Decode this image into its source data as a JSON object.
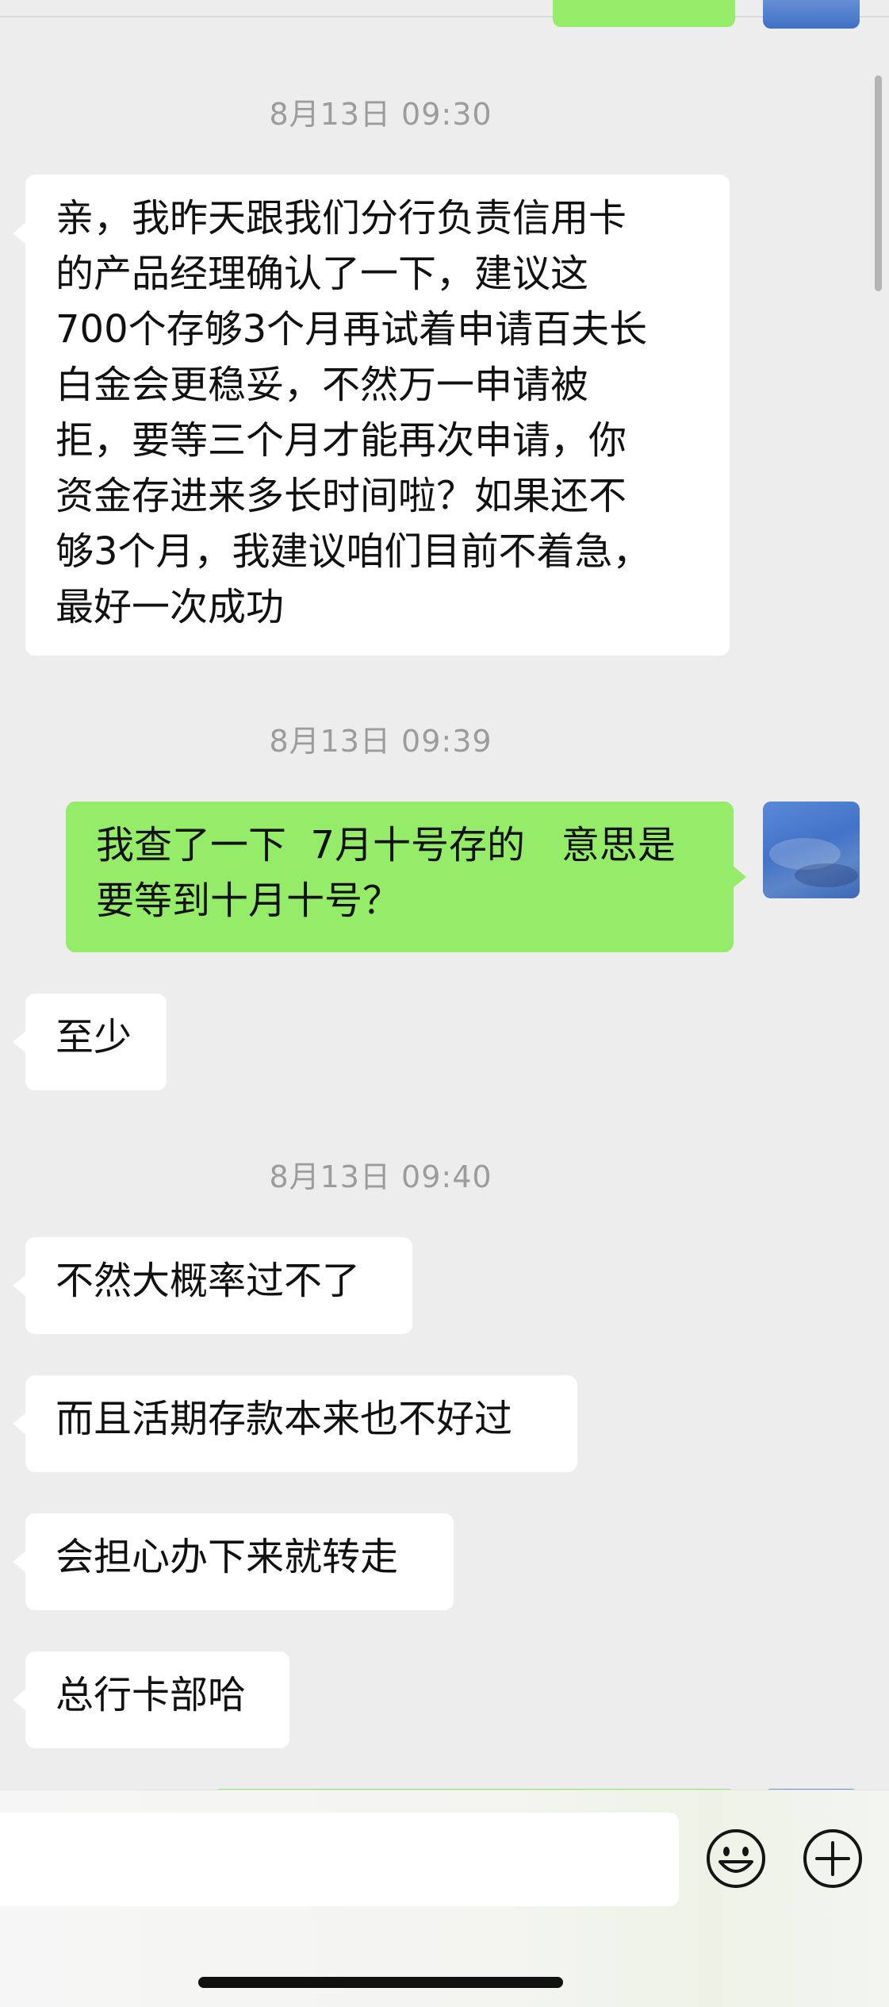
{
  "chat": {
    "timestamps": {
      "t1": "8月13日 09:30",
      "t2": "8月13日 09:39",
      "t3": "8月13日 09:40"
    },
    "messages": {
      "m1": {
        "sender": "other",
        "lines": [
          "亲，我昨天跟我们分行负责信用卡",
          "的产品经理确认了一下，建议这",
          "700个存够3个月再试着申请百夫长",
          "白金会更稳妥，不然万一申请被",
          "拒，要等三个月才能再次申请，你",
          "资金存进来多长时间啦？如果还不",
          "够3个月，我建议咱们目前不着急，",
          "最好一次成功"
        ]
      },
      "m2": {
        "sender": "self",
        "lines": [
          "我查了一下  7月十号存的   意思是",
          "要等到十月十号？"
        ]
      },
      "m3": {
        "sender": "other",
        "text": "至少"
      },
      "m4": {
        "sender": "other",
        "text": "不然大概率过不了"
      },
      "m5": {
        "sender": "other",
        "text": "而且活期存款本来也不好过"
      },
      "m6": {
        "sender": "other",
        "text": "会担心办下来就转走"
      },
      "m7": {
        "sender": "other",
        "text": "总行卡部哈"
      }
    }
  },
  "input_bar": {
    "emoji_icon": "smiley-face-icon",
    "plus_icon": "plus-circle-icon"
  },
  "colors": {
    "background": "#ededed",
    "self_bubble": "#95ec69",
    "other_bubble": "#ffffff",
    "timestamp_text": "#9c9c9c"
  }
}
